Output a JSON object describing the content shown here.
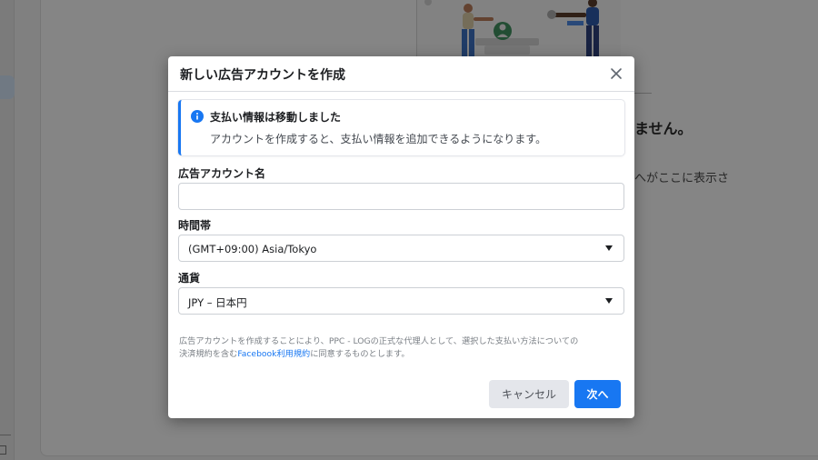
{
  "background": {
    "heading_fragment": "ません。",
    "text_fragment": "へがここに表示さ"
  },
  "modal": {
    "title": "新しい広告アカウントを作成",
    "info": {
      "title": "支払い情報は移動しました",
      "description": "アカウントを作成すると、支払い情報を追加できるようになります。"
    },
    "fields": {
      "account_name": {
        "label": "広告アカウント名",
        "value": "",
        "placeholder": ""
      },
      "timezone": {
        "label": "時間帯",
        "selected": "(GMT+09:00) Asia/Tokyo"
      },
      "currency": {
        "label": "通貨",
        "selected": "JPY – 日本円"
      }
    },
    "terms": {
      "line1": "広告アカウントを作成することにより、PPC - LOGの正式な代理人として、選択した支払い方法についての",
      "line2_before": "決済規約を含む",
      "link": "Facebook利用規約",
      "line2_after": "に同意するものとします。"
    },
    "buttons": {
      "cancel": "キャンセル",
      "next": "次へ"
    }
  },
  "colors": {
    "accent": "#1877f2",
    "cancel_bg": "#e4e6eb"
  },
  "icons": [
    "close-icon",
    "info-icon",
    "chevron-down-icon",
    "illustration"
  ]
}
